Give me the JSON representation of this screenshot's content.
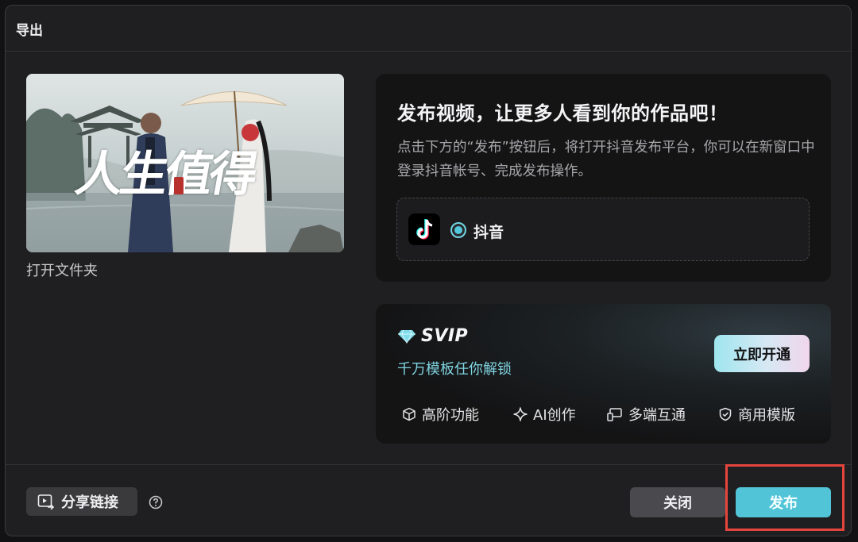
{
  "dialog": {
    "title": "导出"
  },
  "preview": {
    "overlay_text": "人生值得",
    "open_folder_label": "打开文件夹"
  },
  "publish": {
    "heading": "发布视频，让更多人看到你的作品吧！",
    "description": "点击下方的“发布”按钮后，将打开抖音发布平台，你可以在新窗口中登录抖音帐号、完成发布操作。",
    "platform": {
      "icon": "tiktok-icon",
      "label": "抖音",
      "selected": true
    }
  },
  "svip": {
    "badge": "SVIP",
    "subtitle": "千万模板任你解锁",
    "cta_label": "立即开通",
    "features": [
      {
        "icon": "cube-icon",
        "label": "高阶功能"
      },
      {
        "icon": "sparkle-icon",
        "label": "AI创作"
      },
      {
        "icon": "devices-icon",
        "label": "多端互通"
      },
      {
        "icon": "shield-check-icon",
        "label": "商用模版"
      }
    ]
  },
  "footer": {
    "share_label": "分享链接",
    "close_label": "关闭",
    "publish_label": "发布"
  },
  "colors": {
    "accent": "#52c4d8",
    "highlight": "#e5453c",
    "dialog_bg": "#1f1f21"
  }
}
